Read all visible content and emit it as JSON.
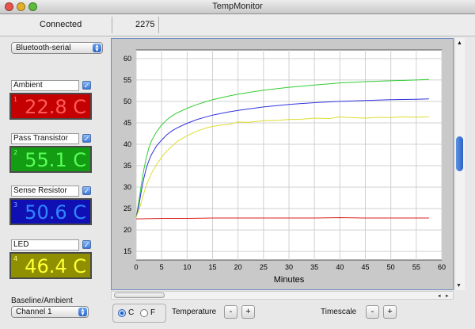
{
  "window": {
    "title": "TempMonitor"
  },
  "status": {
    "connection": "Connected",
    "count": "2275"
  },
  "port_select": {
    "value": "Bluetooth-serial"
  },
  "sensors": [
    {
      "index": "1",
      "label": "Ambient",
      "value": "22.8 C",
      "checked": true,
      "bg": "#c40000",
      "fg": "#ff5a5a"
    },
    {
      "index": "2",
      "label": "Pass Transistor",
      "value": "55.1 C",
      "checked": true,
      "bg": "#129d12",
      "fg": "#59ff59"
    },
    {
      "index": "3",
      "label": "Sense Resistor",
      "value": "50.6 C",
      "checked": true,
      "bg": "#0f0fb4",
      "fg": "#2f86ff"
    },
    {
      "index": "4",
      "label": "LED",
      "value": "46.4 C",
      "checked": true,
      "bg": "#8f8f00",
      "fg": "#ffff33"
    }
  ],
  "baseline": {
    "label": "Baseline/Ambient",
    "value": "Channel 1"
  },
  "units": {
    "c_label": "C",
    "f_label": "F",
    "selected": "C"
  },
  "controls": {
    "temperature_label": "Temperature",
    "timescale_label": "Timescale",
    "minus": "-",
    "plus": "+"
  },
  "chart_data": {
    "type": "line",
    "xlabel": "Minutes",
    "xlim": [
      0,
      60
    ],
    "ylim": [
      13,
      62
    ],
    "xticks": [
      0,
      5,
      10,
      15,
      20,
      25,
      30,
      35,
      40,
      45,
      50,
      55,
      60
    ],
    "yticks": [
      15,
      20,
      25,
      30,
      35,
      40,
      45,
      50,
      55,
      60
    ],
    "grid": true,
    "series": [
      {
        "color": "#33cc33",
        "x": [
          0,
          0.5,
          1,
          1.5,
          2,
          2.5,
          3,
          4,
          5,
          6,
          7,
          8,
          10,
          12,
          15,
          18,
          20,
          25,
          30,
          35,
          40,
          45,
          50,
          55,
          57.5
        ],
        "y": [
          23,
          26.5,
          30.5,
          34,
          37,
          39.2,
          40.8,
          42.9,
          44.5,
          45.7,
          46.6,
          47.3,
          48.4,
          49.3,
          50.4,
          51.2,
          51.7,
          52.6,
          53.3,
          53.8,
          54.3,
          54.6,
          54.8,
          55,
          55.1
        ]
      },
      {
        "color": "#3333dd",
        "x": [
          0,
          0.5,
          1,
          1.5,
          2,
          2.5,
          3,
          4,
          5,
          6,
          7,
          8,
          10,
          12,
          15,
          18,
          20,
          25,
          30,
          35,
          40,
          45,
          50,
          55,
          57.5
        ],
        "y": [
          23,
          25.5,
          29,
          32,
          34.5,
          36.2,
          37.6,
          39.6,
          41,
          42.2,
          43.1,
          43.8,
          44.9,
          45.8,
          46.8,
          47.5,
          47.9,
          48.7,
          49.3,
          49.7,
          50,
          50.2,
          50.4,
          50.5,
          50.6
        ]
      },
      {
        "color": "#dddd33",
        "x": [
          0,
          0.5,
          1,
          1.5,
          2,
          3,
          4,
          5,
          6,
          7,
          8,
          10,
          12,
          14,
          16,
          18,
          20,
          22,
          25,
          28,
          30,
          32,
          35,
          38,
          40,
          42,
          45,
          48,
          50,
          52,
          55,
          57.5
        ],
        "y": [
          23,
          24.5,
          26.5,
          28.5,
          30.5,
          33.2,
          35.2,
          37,
          38.4,
          39.5,
          40.6,
          42,
          43.1,
          43.9,
          44.4,
          44.6,
          45.2,
          45.1,
          45.5,
          45.6,
          45.8,
          45.8,
          46.1,
          46,
          46.4,
          46.2,
          46.1,
          46.3,
          46.2,
          46.4,
          46.3,
          46.4
        ]
      },
      {
        "color": "#dd2222",
        "x": [
          0,
          5,
          10,
          15,
          20,
          25,
          30,
          35,
          40,
          45,
          50,
          55,
          57.5
        ],
        "y": [
          22.6,
          22.7,
          22.7,
          22.8,
          22.8,
          22.8,
          22.8,
          22.8,
          22.9,
          22.8,
          22.8,
          22.8,
          22.8
        ]
      }
    ]
  }
}
